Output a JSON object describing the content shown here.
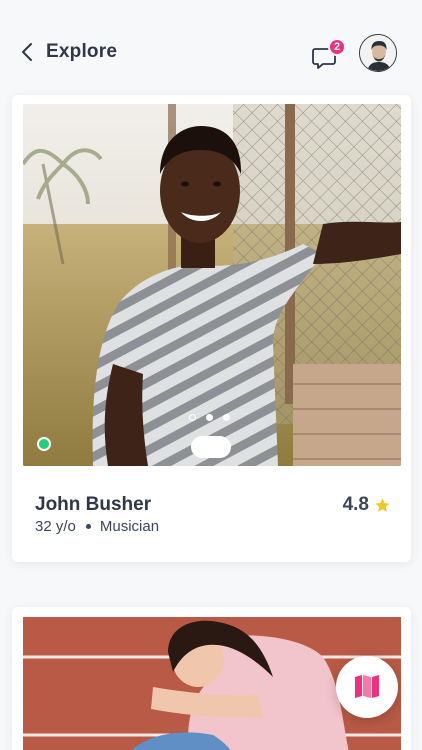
{
  "header": {
    "title": "Explore",
    "chat_badge": "2"
  },
  "profiles": [
    {
      "name": "John Busher",
      "age": "32 y/o",
      "occupation": "Musician",
      "rating": "4.8",
      "online": true,
      "photo_count": 3,
      "active_photo": 1
    },
    {
      "online": false
    }
  ],
  "colors": {
    "accent_pink": "#f0307c",
    "online_green": "#1fd07c",
    "star_yellow": "#f7c623",
    "text_dark": "#2f3749"
  },
  "icons": {
    "back": "back-icon",
    "chat": "chat-bubble-icon",
    "star": "star-icon",
    "fab": "book-icon"
  }
}
